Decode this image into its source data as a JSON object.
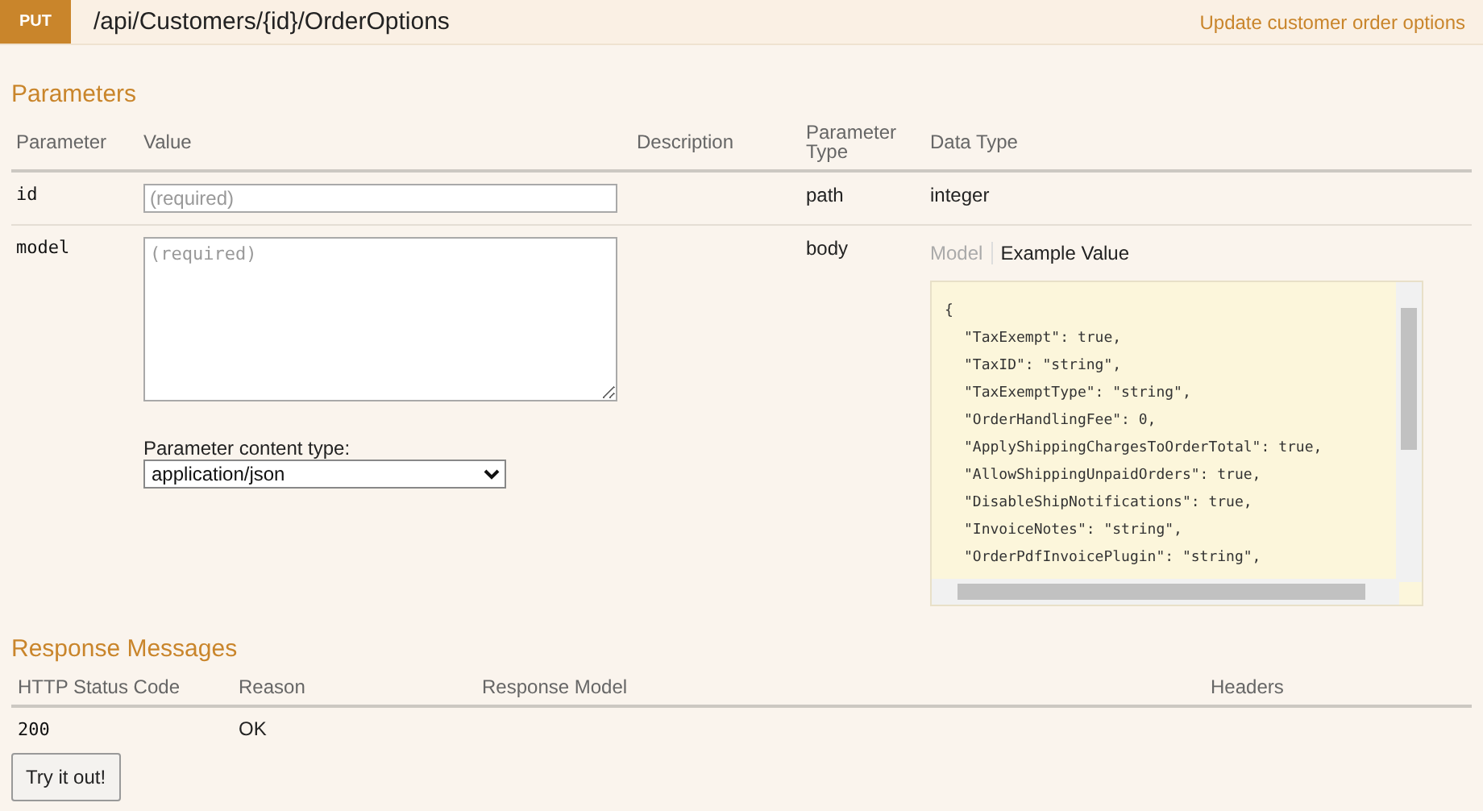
{
  "operation": {
    "method": "PUT",
    "path": "/api/Customers/{id}/OrderOptions",
    "summary": "Update customer order options"
  },
  "parameters": {
    "heading": "Parameters",
    "columns": [
      "Parameter",
      "Value",
      "Description",
      "Parameter Type",
      "Data Type"
    ],
    "rows": [
      {
        "kind": "input",
        "name": "id",
        "placeholder": "(required)",
        "type": "path",
        "data_type": "integer"
      },
      {
        "kind": "body",
        "name": "model",
        "placeholder": "(required)",
        "type": "body",
        "content_type_label": "Parameter content type:",
        "content_type": "application/json",
        "signature_tabs": [
          {
            "label": "Model",
            "selected": false
          },
          {
            "label": "Example Value",
            "selected": true
          }
        ],
        "example": {
          "open": "{",
          "fields": [
            "\"TaxExempt\": true,",
            "\"TaxID\": \"string\",",
            "\"TaxExemptType\": \"string\",",
            "\"OrderHandlingFee\": 0,",
            "\"ApplyShippingChargesToOrderTotal\": true,",
            "\"AllowShippingUnpaidOrders\": true,",
            "\"DisableShipNotifications\": true,",
            "\"InvoiceNotes\": \"string\",",
            "\"OrderPdfInvoicePlugin\": \"string\","
          ]
        }
      }
    ]
  },
  "responses": {
    "heading": "Response Messages",
    "columns": [
      "HTTP Status Code",
      "Reason",
      "Response Model",
      "Headers"
    ],
    "rows": [
      {
        "code": "200",
        "reason": "OK"
      }
    ]
  },
  "try_button": "Try it out!"
}
